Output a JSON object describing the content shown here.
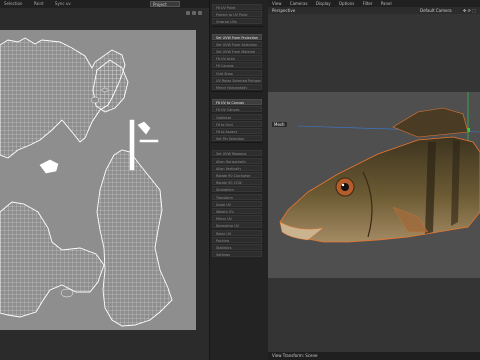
{
  "uv_editor": {
    "menu": [
      "Selection",
      "Paint",
      "Sync uv"
    ],
    "dropdown_value": "Project"
  },
  "command_palette": {
    "items": [
      {
        "label": "Fit UV Point",
        "active": false
      },
      {
        "label": "Project to UV Point",
        "active": false
      },
      {
        "label": "Unwrap UVs",
        "active": false
      },
      {
        "label": "Set UVW From Projection",
        "active": true
      },
      {
        "label": "Set UVW From Selection",
        "active": false
      },
      {
        "label": "Set UVW From Material",
        "active": false
      },
      {
        "label": "Fit UV Area",
        "active": false
      },
      {
        "label": "Fit Canvas",
        "active": false
      },
      {
        "label": "Grid Snap",
        "active": false
      },
      {
        "label": "UV Relax Selected Polygons",
        "active": false
      },
      {
        "label": "Mirror Horizontally",
        "active": false
      },
      {
        "label": "Fit UV to Canvas",
        "active": true
      },
      {
        "label": "Fit UV Canvas",
        "active": false
      },
      {
        "label": "Optimize",
        "active": false
      },
      {
        "label": "Fit to Grid",
        "active": false
      },
      {
        "label": "Fit to Aspect",
        "active": false
      },
      {
        "label": "Set Pin Selection",
        "active": false
      },
      {
        "label": "Set UVW Mapping",
        "active": false
      },
      {
        "label": "Align Horizontally",
        "active": false
      },
      {
        "label": "Align Vertically",
        "active": false
      },
      {
        "label": "Rotate 90 Clockwise",
        "active": false
      },
      {
        "label": "Rotate 90 CCW",
        "active": false
      },
      {
        "label": "Straighten",
        "active": false
      },
      {
        "label": "Transform",
        "active": false
      },
      {
        "label": "Scale UV",
        "active": false
      },
      {
        "label": "Weight UV",
        "active": false
      },
      {
        "label": "Mirror UV",
        "active": false
      },
      {
        "label": "Normalize UV",
        "active": false
      },
      {
        "label": "Relax UV",
        "active": false
      },
      {
        "label": "Packing",
        "active": false
      },
      {
        "label": "Statistics",
        "active": false
      },
      {
        "label": "Settings",
        "active": false
      }
    ]
  },
  "viewport": {
    "menu": [
      "View",
      "Cameras",
      "Display",
      "Options",
      "Filter",
      "Panel"
    ],
    "projection": "Perspective",
    "camera": "Default Camera",
    "mesh_label": "Mesh",
    "footer": "View Transform: Scene"
  },
  "colors": {
    "accent": "#e8772e",
    "uv_lines": "#ffffff",
    "fish_body": "#5a4a2c"
  }
}
